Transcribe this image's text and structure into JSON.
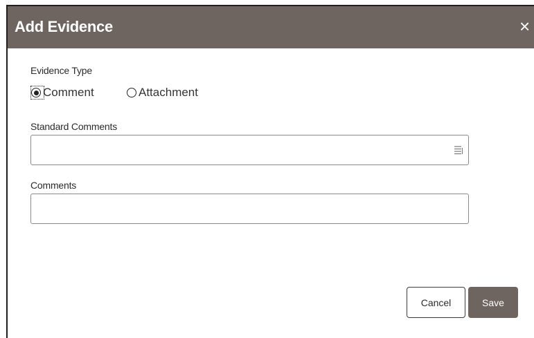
{
  "dialog": {
    "title": "Add Evidence",
    "close_symbol": "×"
  },
  "evidence_type": {
    "label": "Evidence Type",
    "options": [
      "Comment",
      "Attachment"
    ],
    "selected": "Comment"
  },
  "standard_comments": {
    "label": "Standard Comments",
    "value": "",
    "icon": "list-icon"
  },
  "comments": {
    "label": "Comments",
    "value": ""
  },
  "buttons": {
    "cancel": "Cancel",
    "save": "Save"
  },
  "colors": {
    "header_bg": "#6e6560",
    "save_bg": "#6e6560",
    "text": "#2b2b2b"
  }
}
